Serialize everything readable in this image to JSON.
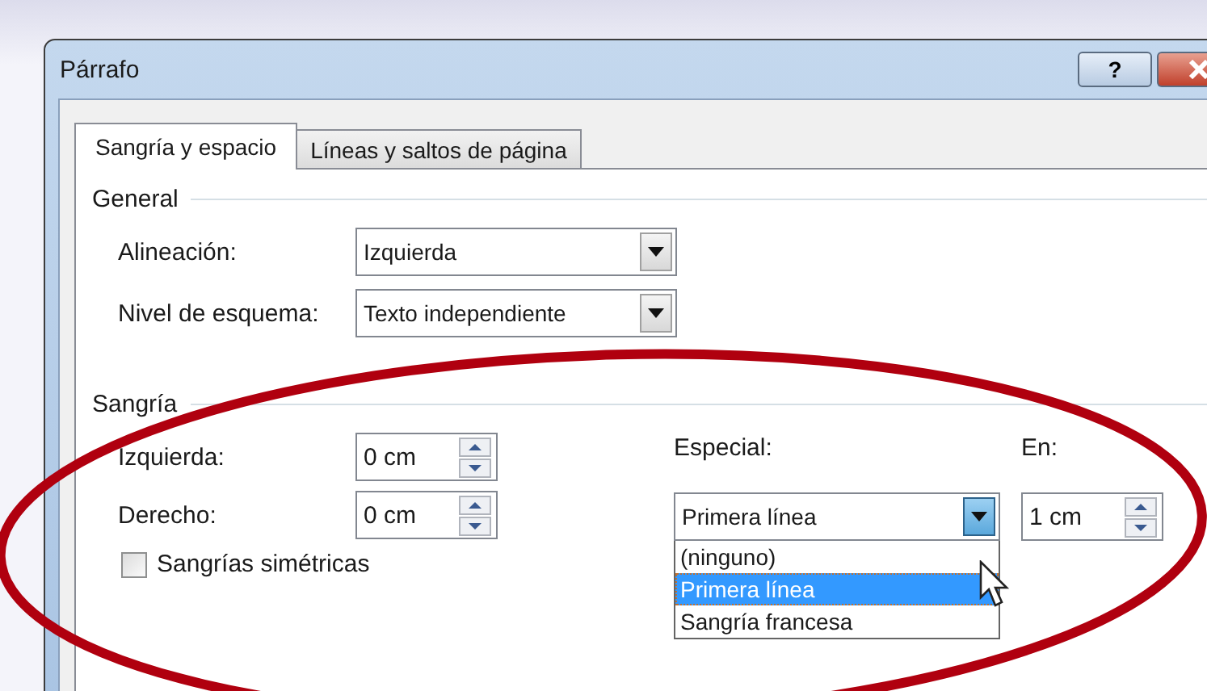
{
  "window": {
    "title": "Párrafo",
    "help_label": "?"
  },
  "tabs": [
    {
      "label": "Sangría y espacio",
      "selected": true
    },
    {
      "label": "Líneas y saltos de página",
      "selected": false
    }
  ],
  "general": {
    "title": "General",
    "rows": [
      {
        "label": "Alineación:",
        "value": "Izquierda"
      },
      {
        "label": "Nivel de esquema:",
        "value": "Texto independiente"
      }
    ]
  },
  "indent": {
    "title": "Sangría",
    "spinners": [
      {
        "label": "Izquierda:",
        "value": "0 cm"
      },
      {
        "label": "Derecho:",
        "value": "0 cm"
      }
    ],
    "mirror": {
      "label": "Sangrías simétricas",
      "checked": false
    },
    "special": {
      "label": "Especial:",
      "value": "Primera línea",
      "expanded": true,
      "options": [
        {
          "label": "(ninguno)",
          "selected": false
        },
        {
          "label": "Primera línea",
          "selected": true
        },
        {
          "label": "Sangría francesa",
          "selected": false
        }
      ]
    },
    "by": {
      "label": "En:",
      "value": "1 cm"
    }
  }
}
